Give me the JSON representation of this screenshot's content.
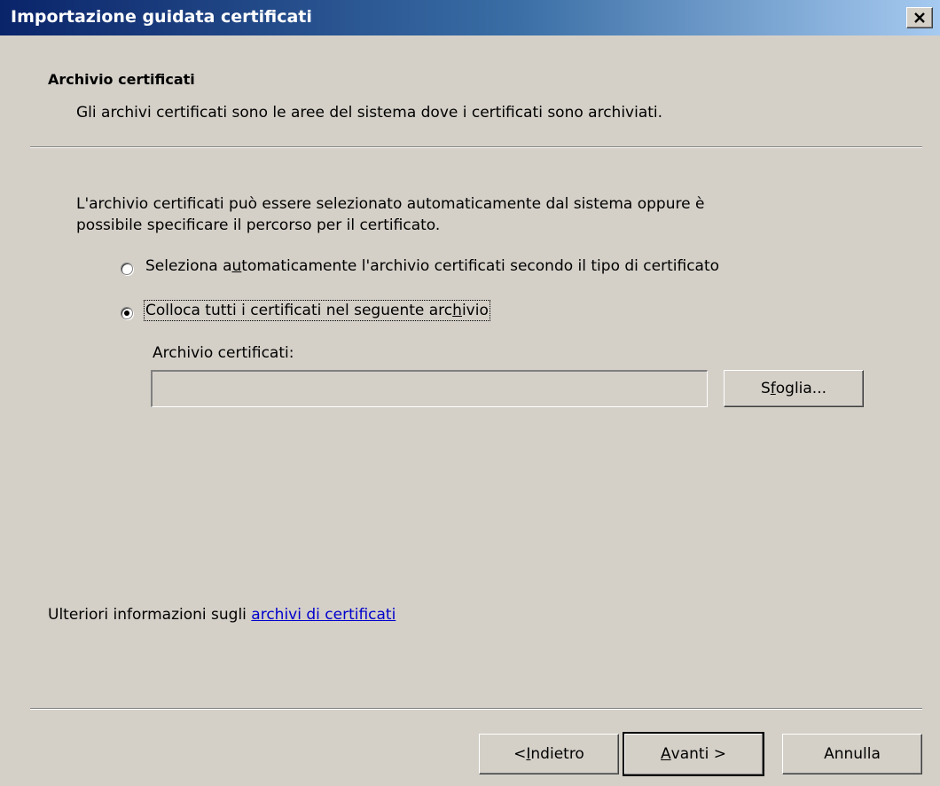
{
  "window": {
    "title": "Importazione guidata certificati",
    "close_icon": "close-icon"
  },
  "header": {
    "title": "Archivio certificati",
    "subtitle": "Gli archivi certificati sono le aree del sistema dove i certificati sono archiviati."
  },
  "body": {
    "intro_line1": "L'archivio certificati può essere selezionato automaticamente dal sistema oppure è",
    "intro_line2": "possibile specificare il percorso per il certificato.",
    "radio_auto": {
      "pre": "Seleziona a",
      "accel": "u",
      "post": "tomaticamente l'archivio certificati secondo il tipo di certificato",
      "selected": false
    },
    "radio_manual": {
      "pre": "Colloca tutti i certificati nel seguente arc",
      "accel": "h",
      "post": "ivio",
      "selected": true
    },
    "store_label": "Archivio certificati:",
    "store_value": "",
    "browse": {
      "pre": "S",
      "accel": "f",
      "post": "oglia..."
    }
  },
  "footer": {
    "info_text": "Ulteriori informazioni sugli ",
    "info_link": "archivi di certificati",
    "back": {
      "pre": "< ",
      "accel": "I",
      "post": "ndietro"
    },
    "next": {
      "pre": "",
      "accel": "A",
      "post": "vanti >"
    },
    "cancel": "Annulla"
  }
}
